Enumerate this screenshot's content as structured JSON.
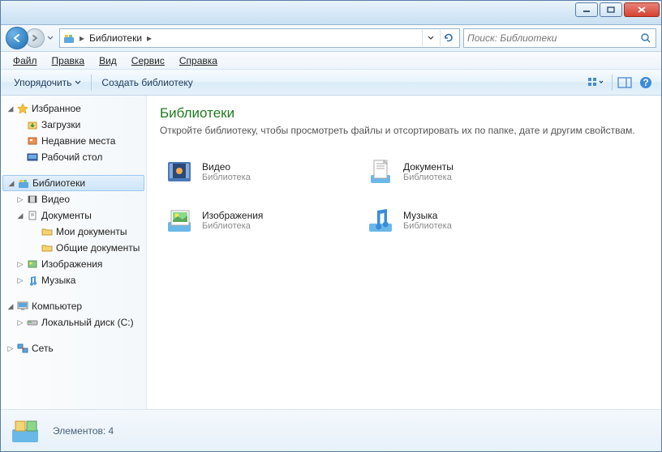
{
  "search": {
    "placeholder": "Поиск: Библиотеки"
  },
  "breadcrumb": {
    "root": "Библиотеки"
  },
  "menu": {
    "file": "Файл",
    "edit": "Правка",
    "view": "Вид",
    "tools": "Сервис",
    "help": "Справка"
  },
  "toolbar": {
    "organize": "Упорядочить",
    "create_library": "Создать библиотеку"
  },
  "sidebar": {
    "favorites": {
      "label": "Избранное",
      "items": [
        "Загрузки",
        "Недавние места",
        "Рабочий стол"
      ]
    },
    "libraries": {
      "label": "Библиотеки",
      "items": [
        "Видео",
        "Документы",
        "Изображения",
        "Музыка"
      ],
      "docs_children": [
        "Мои документы",
        "Общие документы"
      ]
    },
    "computer": {
      "label": "Компьютер",
      "items": [
        "Локальный диск (C:)"
      ]
    },
    "network": {
      "label": "Сеть"
    }
  },
  "content": {
    "title": "Библиотеки",
    "subtitle": "Откройте библиотеку, чтобы просмотреть файлы и отсортировать их по папке, дате и другим свойствам.",
    "type_label": "Библиотека",
    "items": [
      {
        "name": "Видео"
      },
      {
        "name": "Документы"
      },
      {
        "name": "Изображения"
      },
      {
        "name": "Музыка"
      }
    ]
  },
  "status": {
    "count_label": "Элементов: 4"
  }
}
